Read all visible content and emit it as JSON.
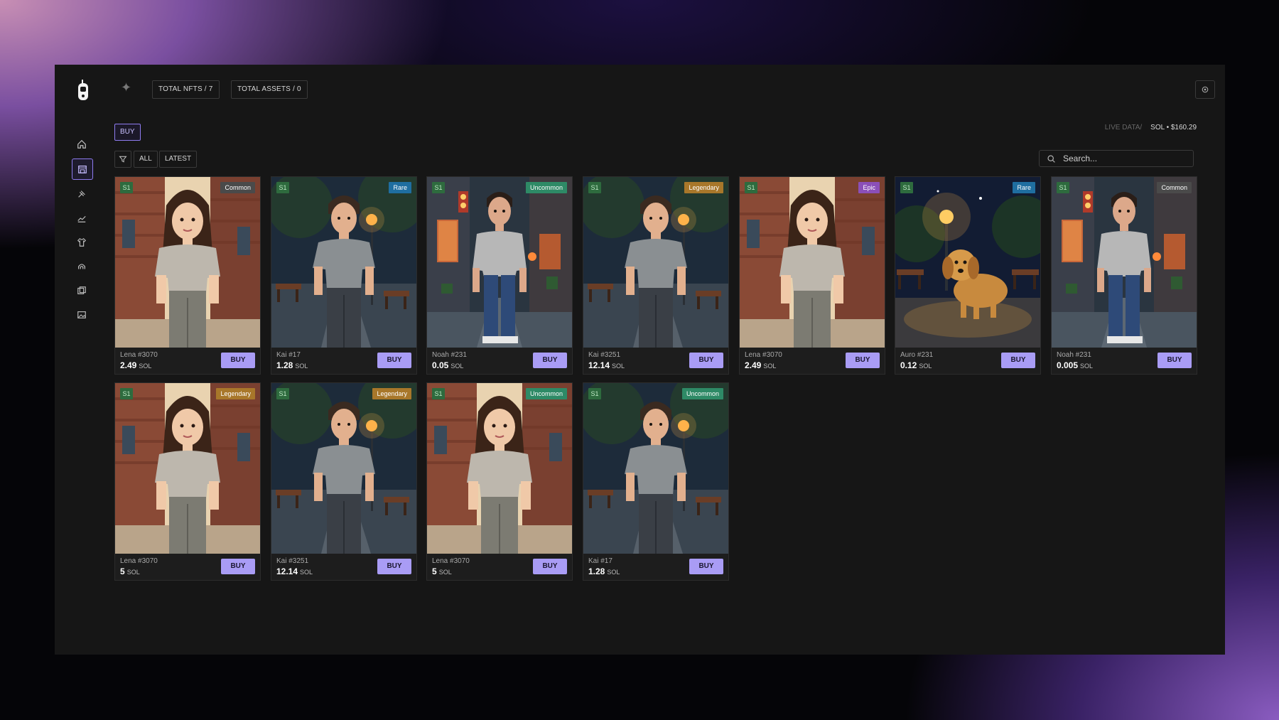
{
  "header": {
    "total_nfts": "TOTAL NFTS / 7",
    "total_assets": "TOTAL ASSETS / 0"
  },
  "sidebar": {
    "items": [
      {
        "icon": "home-icon"
      },
      {
        "icon": "store-icon",
        "active": true
      },
      {
        "icon": "hammer-icon"
      },
      {
        "icon": "chart-icon"
      },
      {
        "icon": "shirt-icon"
      },
      {
        "icon": "arch-icon"
      },
      {
        "icon": "layers-icon"
      },
      {
        "icon": "image-icon"
      }
    ]
  },
  "tabs": {
    "buy": "BUY"
  },
  "live": {
    "label": "LIVE DATA/",
    "sol": "SOL • $160.29"
  },
  "filters": {
    "all": "ALL",
    "latest": "LATEST"
  },
  "search": {
    "placeholder": "Search..."
  },
  "colors": {
    "accent": "#a99cf5",
    "Common": "#4a4a4a",
    "Rare": "#1f6ea0",
    "Uncommon": "#2e8a66",
    "Legendary": "#a8772a",
    "Epic": "#8b4fb8"
  },
  "cards": [
    {
      "season": "S1",
      "rarity": "Common",
      "name": "Lena #3070",
      "price": "2.49",
      "unit": "SOL",
      "buy": "BUY",
      "art": "girl"
    },
    {
      "season": "S1",
      "rarity": "Rare",
      "name": "Kai #17",
      "price": "1.28",
      "unit": "SOL",
      "buy": "BUY",
      "art": "boy"
    },
    {
      "season": "S1",
      "rarity": "Uncommon",
      "name": "Noah #231",
      "price": "0.05",
      "unit": "SOL",
      "buy": "BUY",
      "art": "noah"
    },
    {
      "season": "S1",
      "rarity": "Legendary",
      "name": "Kai #3251",
      "price": "12.14",
      "unit": "SOL",
      "buy": "BUY",
      "art": "boy"
    },
    {
      "season": "S1",
      "rarity": "Epic",
      "name": "Lena #3070",
      "price": "2.49",
      "unit": "SOL",
      "buy": "BUY",
      "art": "girl"
    },
    {
      "season": "S1",
      "rarity": "Rare",
      "name": "Auro #231",
      "price": "0.12",
      "unit": "SOL",
      "buy": "BUY",
      "art": "dog"
    },
    {
      "season": "S1",
      "rarity": "Common",
      "name": "Noah #231",
      "price": "0.005",
      "unit": "SOL",
      "buy": "BUY",
      "art": "noah"
    },
    {
      "season": "S1",
      "rarity": "Legendary",
      "name": "Lena #3070",
      "price": "5",
      "unit": "SOL",
      "buy": "BUY",
      "art": "girl"
    },
    {
      "season": "S1",
      "rarity": "Legendary",
      "name": "Kai #3251",
      "price": "12.14",
      "unit": "SOL",
      "buy": "BUY",
      "art": "boy"
    },
    {
      "season": "S1",
      "rarity": "Uncommon",
      "name": "Lena #3070",
      "price": "5",
      "unit": "SOL",
      "buy": "BUY",
      "art": "girl"
    },
    {
      "season": "S1",
      "rarity": "Uncommon",
      "name": "Kai #17",
      "price": "1.28",
      "unit": "SOL",
      "buy": "BUY",
      "art": "boy"
    }
  ]
}
